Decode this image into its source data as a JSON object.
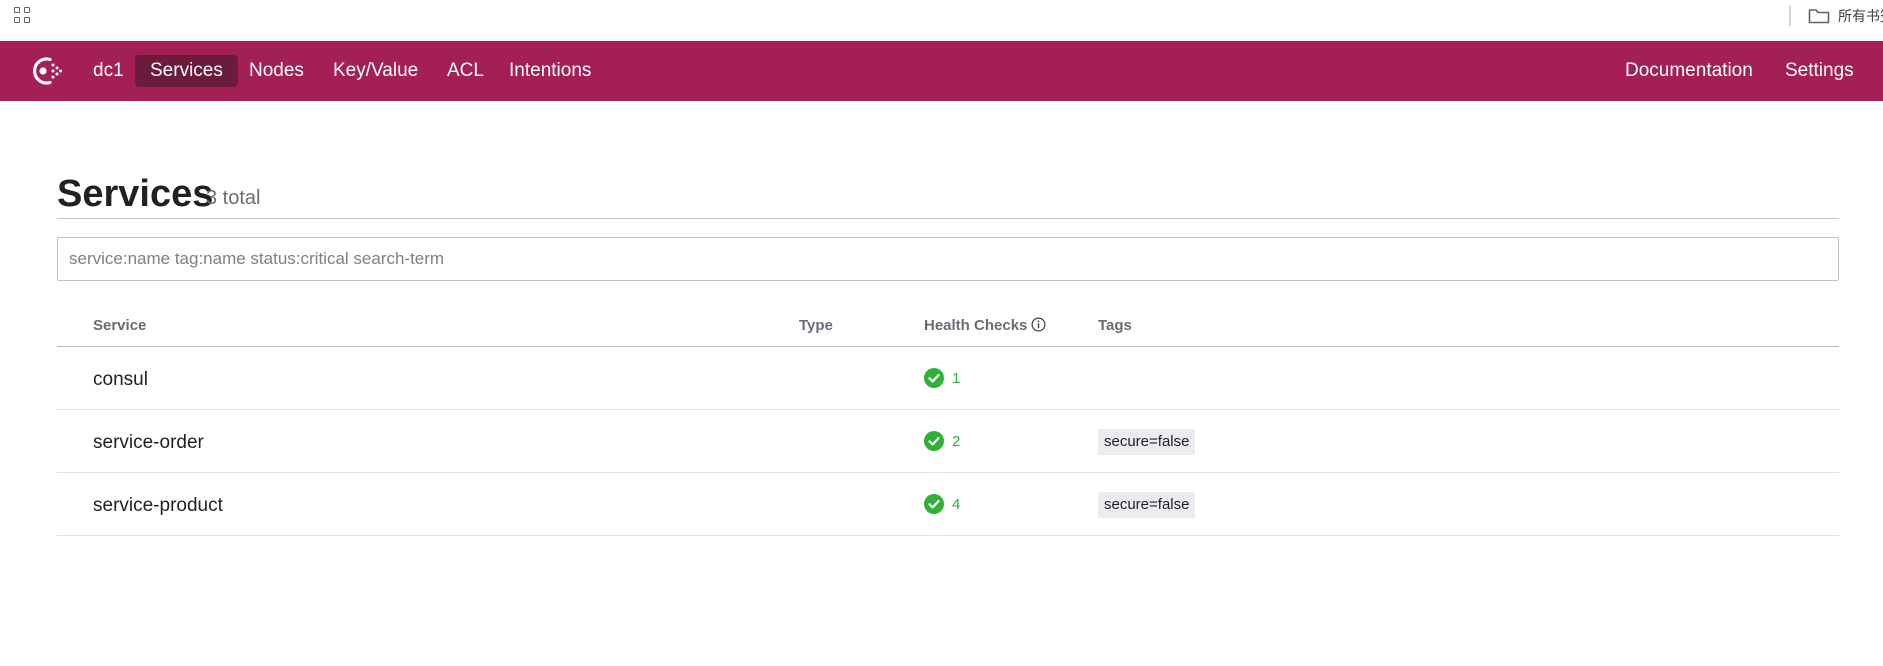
{
  "browser": {
    "bookmarks_folder": "所有书签"
  },
  "nav": {
    "datacenter": "dc1",
    "items": [
      {
        "label": "Services",
        "active": true
      },
      {
        "label": "Nodes",
        "active": false
      },
      {
        "label": "Key/Value",
        "active": false
      },
      {
        "label": "ACL",
        "active": false
      },
      {
        "label": "Intentions",
        "active": false
      }
    ],
    "right_items": [
      {
        "label": "Documentation"
      },
      {
        "label": "Settings"
      }
    ],
    "brand_color": "#a31f56",
    "active_color": "#6c1c3b"
  },
  "page": {
    "title": "Services",
    "count": "3 total"
  },
  "search": {
    "placeholder": "service:name tag:name status:critical search-term",
    "value": ""
  },
  "table": {
    "headers": {
      "service": "Service",
      "type": "Type",
      "health": "Health Checks",
      "tags": "Tags"
    },
    "rows": [
      {
        "name": "consul",
        "type": "",
        "health_passing": "1",
        "tags": []
      },
      {
        "name": "service-order",
        "type": "",
        "health_passing": "2",
        "tags": [
          "secure=false"
        ]
      },
      {
        "name": "service-product",
        "type": "",
        "health_passing": "4",
        "tags": [
          "secure=false"
        ]
      }
    ],
    "passing_color": "#2eb039"
  }
}
